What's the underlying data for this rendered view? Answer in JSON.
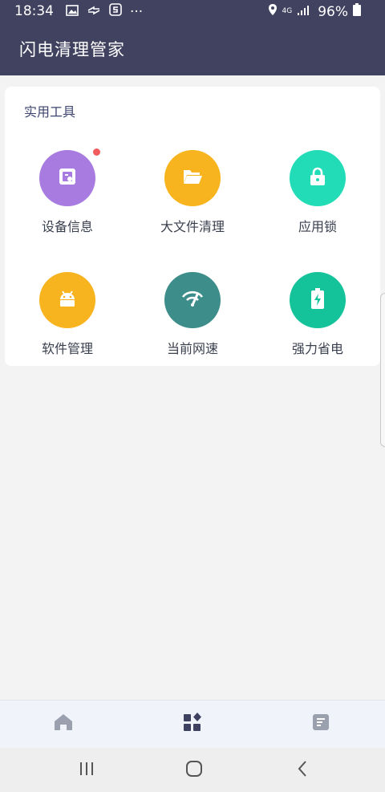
{
  "status_bar": {
    "time": "18:34",
    "network": "4G",
    "battery": "96%",
    "overflow": "···"
  },
  "app_bar": {
    "title": "闪电清理管家"
  },
  "tools_section": {
    "title": "实用工具",
    "tools": [
      {
        "label": "设备信息",
        "color": "#a77be0",
        "icon": "device-info-icon",
        "badge": true
      },
      {
        "label": "大文件清理",
        "color": "#f7b41f",
        "icon": "folder-icon",
        "badge": false
      },
      {
        "label": "应用锁",
        "color": "#22dcb7",
        "icon": "lock-icon",
        "badge": false
      },
      {
        "label": "软件管理",
        "color": "#f7b41f",
        "icon": "android-icon",
        "badge": false
      },
      {
        "label": "当前网速",
        "color": "#3d8e8b",
        "icon": "network-speed-icon",
        "badge": false
      },
      {
        "label": "强力省电",
        "color": "#14c39a",
        "icon": "battery-saver-icon",
        "badge": false
      }
    ]
  },
  "bottom_nav": {
    "items": [
      {
        "icon": "home-icon",
        "active": false
      },
      {
        "icon": "apps-grid-icon",
        "active": true
      },
      {
        "icon": "document-icon",
        "active": false
      }
    ]
  },
  "colors": {
    "header": "#414260",
    "nav_inactive": "#9aa0ad",
    "nav_active": "#3f4160"
  }
}
